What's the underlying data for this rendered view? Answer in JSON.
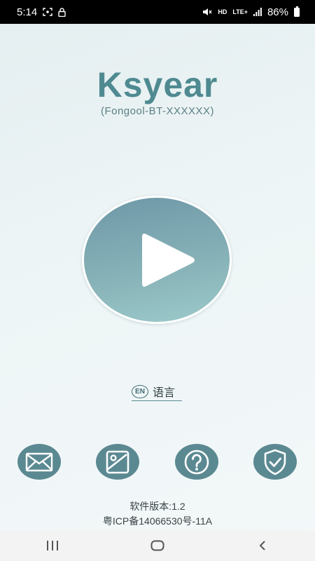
{
  "status_bar": {
    "time": "5:14",
    "network_label": "LTE+",
    "hd_label": "HD",
    "battery": "86%"
  },
  "app": {
    "title": "Ksyear",
    "subtitle": "(Fongool-BT-XXXXXX)"
  },
  "language": {
    "badge": "EN",
    "label": "语言"
  },
  "actions": [
    {
      "icon": "mail-icon"
    },
    {
      "icon": "image-icon"
    },
    {
      "icon": "help-icon"
    },
    {
      "icon": "shield-check-icon"
    }
  ],
  "footer": {
    "version": "软件版本:1.2",
    "icp": "粤ICP备14066530号-11A"
  },
  "colors": {
    "accent": "#5b8992",
    "title": "#4f8a91",
    "play_gradient_top": "#6f98a8",
    "play_gradient_bottom": "#9ccaca"
  }
}
